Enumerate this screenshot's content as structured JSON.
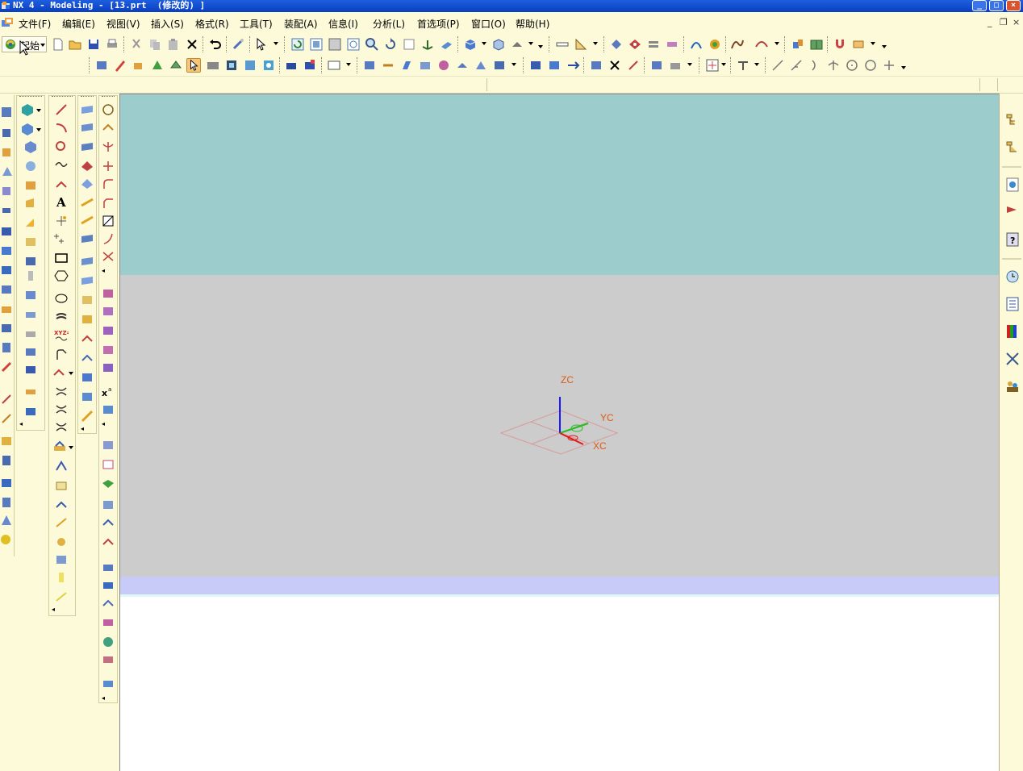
{
  "window": {
    "title": "NX 4 - Modeling - [13.prt  (修改的) ]",
    "controls": [
      "minimize",
      "maximize",
      "close"
    ]
  },
  "menubar": {
    "items": [
      "文件(F)",
      "编辑(E)",
      "视图(V)",
      "插入(S)",
      "格式(R)",
      "工具(T)",
      "装配(A)",
      "信息(I)",
      "分析(L)",
      "首选项(P)",
      "窗口(O)",
      "帮助(H)"
    ],
    "doc_controls": [
      "minimize",
      "restore",
      "close"
    ]
  },
  "toolbar": {
    "start_label": "起始"
  },
  "viewport": {
    "background_top": "#9ccccc",
    "background_middle": "#cccccc",
    "band_color": "#c8caf8",
    "axes": {
      "zc": "ZC",
      "yc": "YC",
      "xc": "XC"
    },
    "colors": {
      "zc_axis": "#1a1aff",
      "yc_axis": "#22c022",
      "xc_axis": "#e01a1a",
      "label": "#e05a10",
      "plane": "#d89a9a"
    }
  },
  "palette": {
    "panel_bg": "#fcfad8",
    "title_bar": "#0a3fbf",
    "active_tool": "#f4c67a"
  }
}
